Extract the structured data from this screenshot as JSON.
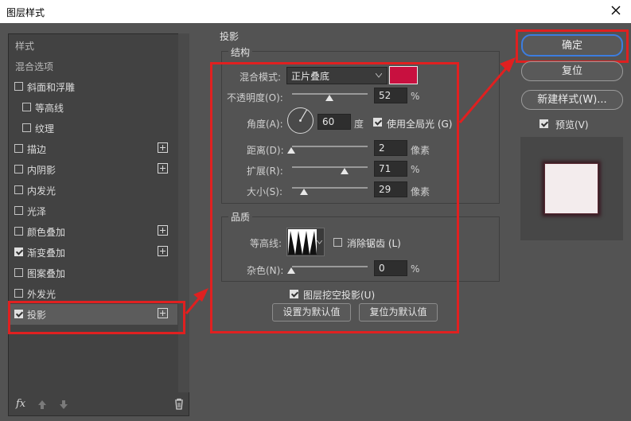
{
  "window": {
    "title": "图层样式"
  },
  "left_panel": {
    "items": [
      {
        "label": "样式",
        "checkbox": false,
        "checked": false,
        "plus": false
      },
      {
        "label": "混合选项",
        "checkbox": false,
        "checked": false,
        "plus": false
      },
      {
        "label": "斜面和浮雕",
        "checkbox": true,
        "checked": false,
        "plus": false
      },
      {
        "label": "等高线",
        "checkbox": true,
        "checked": false,
        "plus": false
      },
      {
        "label": "纹理",
        "checkbox": true,
        "checked": false,
        "plus": false
      },
      {
        "label": "描边",
        "checkbox": true,
        "checked": false,
        "plus": true
      },
      {
        "label": "内阴影",
        "checkbox": true,
        "checked": false,
        "plus": true
      },
      {
        "label": "内发光",
        "checkbox": true,
        "checked": false,
        "plus": false
      },
      {
        "label": "光泽",
        "checkbox": true,
        "checked": false,
        "plus": false
      },
      {
        "label": "颜色叠加",
        "checkbox": true,
        "checked": false,
        "plus": true
      },
      {
        "label": "渐变叠加",
        "checkbox": true,
        "checked": true,
        "plus": true
      },
      {
        "label": "图案叠加",
        "checkbox": true,
        "checked": false,
        "plus": false
      },
      {
        "label": "外发光",
        "checkbox": true,
        "checked": false,
        "plus": false
      },
      {
        "label": "投影",
        "checkbox": true,
        "checked": true,
        "plus": true
      }
    ],
    "footer": {
      "fx_label": "fx"
    }
  },
  "drop_shadow": {
    "title": "投影",
    "structure": {
      "title": "结构",
      "blend_mode_label": "混合模式:",
      "blend_mode_value": "正片叠底",
      "color_swatch": "#c8103f",
      "opacity_label": "不透明度(O):",
      "opacity_value": "52",
      "opacity_unit": "%",
      "angle_label": "角度(A):",
      "angle_value": "60",
      "angle_unit": "度",
      "global_light_label": "使用全局光 (G)",
      "global_light_checked": true,
      "distance_label": "距离(D):",
      "distance_value": "2",
      "distance_unit": "像素",
      "spread_label": "扩展(R):",
      "spread_value": "71",
      "spread_unit": "%",
      "size_label": "大小(S):",
      "size_value": "29",
      "size_unit": "像素"
    },
    "quality": {
      "title": "品质",
      "contour_label": "等高线:",
      "antialias_label": "消除锯齿 (L)",
      "antialias_checked": false,
      "noise_label": "杂色(N):",
      "noise_value": "0",
      "noise_unit": "%"
    },
    "knockout_label": "图层挖空投影(U)",
    "knockout_checked": true,
    "make_default_label": "设置为默认值",
    "reset_default_label": "复位为默认值"
  },
  "right_panel": {
    "ok_label": "确定",
    "reset_label": "复位",
    "new_style_label": "新建样式(W)...",
    "preview_label": "预览(V)",
    "preview_checked": true
  },
  "colors": {
    "highlight": "#e02020",
    "ok_ring": "#3c7de0",
    "swatch": "#c8103f"
  }
}
